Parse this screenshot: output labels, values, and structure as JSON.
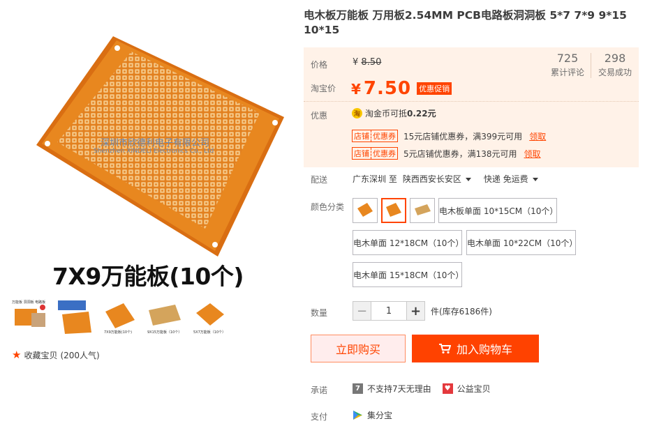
{
  "gallery": {
    "main_overlay_text": "深圳市欣德利电子有限公司",
    "main_overlay_text_en": "Shenzhen XINDELI Electronics Co., Ltd",
    "main_caption": "7X9万能板(10个)",
    "thumbs": [
      {
        "label": "万能板 洞洞板 电路板"
      },
      {
        "label": ""
      },
      {
        "label": "7X9万能板(10个)"
      },
      {
        "label": "9X15万能板（10个）"
      },
      {
        "label": "5X7万能板（10个）"
      }
    ]
  },
  "favorite": {
    "icon": "star-icon",
    "label": "收藏宝贝",
    "popularity": "(200人气)"
  },
  "product": {
    "title": "电木板万能板 万用板2.54MM PCB电路板洞洞板 5*7 7*9 9*15 10*15"
  },
  "price": {
    "label": "价格",
    "original": "8.50",
    "currency": "¥",
    "tb_label": "淘宝价",
    "tb_price": "7.50",
    "promo_tag": "优惠促销",
    "reviews_count": "725",
    "reviews_label": "累计评论",
    "deals_count": "298",
    "deals_label": "交易成功"
  },
  "discount": {
    "label": "优惠",
    "coin_icon": "taojinbi-coin-icon",
    "coin_glyph": "淘",
    "coin_text": "淘金币可抵",
    "coin_amount": "0.22元",
    "coupons": [
      {
        "tag_a": "店铺",
        "tag_b": "优惠券",
        "text": "15元店铺优惠券，满399元可用",
        "action": "领取"
      },
      {
        "tag_a": "店铺",
        "tag_b": "优惠券",
        "text": "5元店铺优惠券，满138元可用",
        "action": "领取"
      }
    ]
  },
  "shipping": {
    "label": "配送",
    "from": "广东深圳 至",
    "to": "陕西西安长安区",
    "method": "快递 免运费"
  },
  "color": {
    "label": "颜色分类",
    "options": [
      {
        "label": "电木板单面 10*15CM（10个）"
      },
      {
        "label": "电木单面 12*18CM（10个）"
      },
      {
        "label": "电木单面 10*22CM（10个）"
      },
      {
        "label": "电木单面 15*18CM（10个）"
      }
    ],
    "selected_image_index": 1
  },
  "quantity": {
    "label": "数量",
    "value": "1",
    "minus": "−",
    "plus": "+",
    "stock": "件(库存6186件)"
  },
  "actions": {
    "buy_now": "立即购买",
    "add_cart": "加入购物车",
    "cart_icon": "cart-icon"
  },
  "promise": {
    "label": "承诺",
    "items": [
      {
        "icon": "no-return-icon",
        "glyph": "7",
        "text": "不支持7天无理由"
      },
      {
        "icon": "charity-icon",
        "glyph": "♥",
        "text": "公益宝贝"
      }
    ]
  },
  "payment": {
    "label": "支付",
    "icon": "jifenbao-icon",
    "text": "集分宝"
  },
  "colors": {
    "accent": "#ff4400",
    "price_bg": "#fff2e8",
    "board": "#e87a1c"
  }
}
